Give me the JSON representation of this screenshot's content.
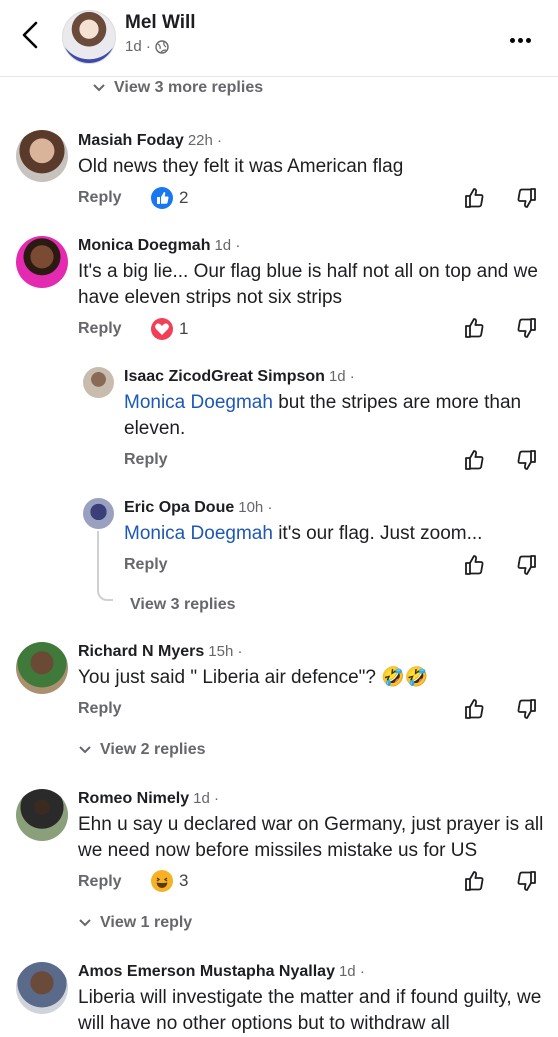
{
  "header": {
    "name": "Mel Will",
    "meta": "1d ·"
  },
  "top_view_more": "View 3 more replies",
  "comments": [
    {
      "name": "Masiah Foday",
      "time": "22h ·",
      "text": "Old news  they felt it was American flag",
      "reply": "Reply",
      "reaction_count": "2",
      "reaction": "like"
    },
    {
      "name": "Monica Doegmah",
      "time": "1d ·",
      "text": "It's a big lie... Our flag blue is half not all on top and we have eleven strips not six strips",
      "reply": "Reply",
      "reaction_count": "1",
      "reaction": "love"
    },
    {
      "name": "Isaac ZicodGreat Simpson",
      "time": "1d ·",
      "mention": "Monica Doegmah",
      "text": " but the stripes are more than eleven.",
      "reply": "Reply"
    },
    {
      "name": "Eric Opa Doue",
      "time": "10h ·",
      "mention": "Monica Doegmah",
      "text": " it's our flag. Just zoom...",
      "reply": "Reply"
    },
    {
      "name": "Richard N Myers",
      "time": "15h ·",
      "text": "You just said \" Liberia air defence\"? 🤣🤣",
      "reply": "Reply"
    },
    {
      "name": "Romeo Nimely",
      "time": "1d ·",
      "text": "Ehn u say u declared war on Germany, just prayer is all we need now before missiles mistake us for US",
      "reply": "Reply",
      "reaction_count": "3",
      "reaction": "haha"
    },
    {
      "name": "Amos Emerson Mustapha Nyallay",
      "time": "1d ·",
      "text": "Liberia will investigate the matter and if found guilty, we will have no other options but to withdraw all"
    }
  ],
  "view_replies": {
    "monica": "View 3 replies",
    "richard": "View 2 replies",
    "romeo": "View 1 reply"
  },
  "colors": {
    "like": "#1877f2",
    "love": "#f33e58",
    "haha": "#f7b125",
    "mention": "#1d58b6"
  }
}
